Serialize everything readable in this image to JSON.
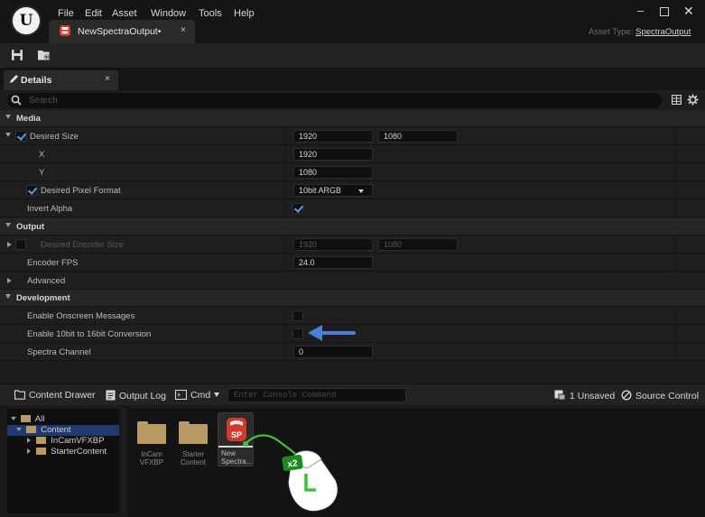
{
  "menu": [
    "File",
    "Edit",
    "Asset",
    "Window",
    "Tools",
    "Help"
  ],
  "document_tab": {
    "label": "NewSpectraOutput•",
    "close": "×"
  },
  "window_controls": {
    "minimize": "–",
    "close": "✕"
  },
  "asset_type": {
    "prefix": "Asset Type:",
    "value": "SpectraOutput"
  },
  "details_tab": {
    "label": "Details",
    "close": "×"
  },
  "search": {
    "placeholder": "Search",
    "value": ""
  },
  "sections": {
    "media": {
      "label": "Media",
      "desired_size": {
        "label": "Desired Size",
        "checked": true,
        "x_value": "1920",
        "y_value": "1080"
      },
      "x": {
        "label": "X",
        "value": "1920"
      },
      "y": {
        "label": "Y",
        "value": "1080"
      },
      "pixel_format": {
        "label": "Desired Pixel Format",
        "checked": true,
        "value": "10bit ARGB"
      },
      "invert_alpha": {
        "label": "Invert Alpha",
        "checked": true
      }
    },
    "output": {
      "label": "Output",
      "encoder_size": {
        "label": "Desired Encoder Size",
        "checked": false,
        "x_value": "1920",
        "y_value": "1080"
      },
      "encoder_fps": {
        "label": "Encoder FPS",
        "value": "24.0"
      },
      "advanced": {
        "label": "Advanced"
      }
    },
    "development": {
      "label": "Development",
      "onscreen_messages": {
        "label": "Enable Onscreen Messages",
        "checked": false
      },
      "conversion": {
        "label": "Enable 10bit to 16bit Conversion",
        "checked": false
      },
      "spectra_channel": {
        "label": "Spectra Channel",
        "value": "0"
      }
    }
  },
  "bottom_bar": {
    "content_drawer": "Content Drawer",
    "output_log": "Output Log",
    "cmd": "Cmd",
    "console_placeholder": "Enter Console Command",
    "unsaved": "1 Unsaved",
    "source_control": "Source Control"
  },
  "tree": {
    "all": "All",
    "content": "Content",
    "children": [
      "InCamVFXBP",
      "StarterContent"
    ]
  },
  "assets": [
    {
      "name_line1": "InCam",
      "name_line2": "VFXBP"
    },
    {
      "name_line1": "Starter",
      "name_line2": "Content"
    },
    {
      "name_line1": "New",
      "name_line2": "Spectra..."
    }
  ],
  "spectra_icon_text": "SP",
  "mouse_hint": {
    "badge": "x2",
    "button": "L"
  },
  "colors": {
    "accent_blue": "#4fa4f0",
    "annotation_arrow": "#4a7fd4",
    "annotation_cable": "#3ec23e",
    "folder": "#b99a64",
    "spectra_icon": "#d23a2a"
  },
  "icons": {
    "save": "save-icon",
    "browse": "browse-icon",
    "details": "pencil-icon",
    "search": "search-icon",
    "table": "table-icon",
    "settings": "settings-icon",
    "content_drawer": "content-drawer-icon",
    "output_log": "output-log-icon",
    "cmd": "console-icon",
    "unsaved": "unsaved-icon",
    "source_control": "source-control-icon"
  }
}
